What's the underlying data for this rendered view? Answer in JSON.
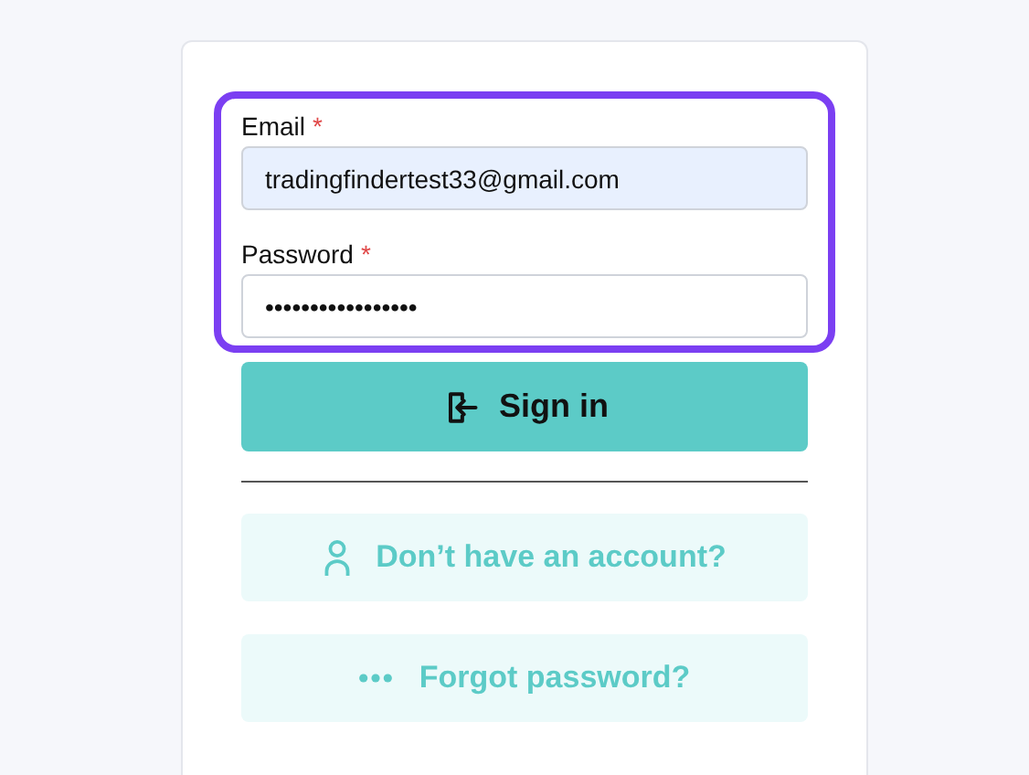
{
  "form": {
    "fields": [
      {
        "label": "Email",
        "required_mark": "*",
        "value": "tradingfindertest33@gmail.com",
        "filled": true
      },
      {
        "label": "Password",
        "required_mark": "*",
        "value": "•••••••••••••••••",
        "filled": false
      }
    ],
    "submit": {
      "label": "Sign in"
    },
    "links": [
      {
        "kind": "account",
        "label": "Don’t have an account?"
      },
      {
        "kind": "forgot",
        "label": "Forgot password?"
      }
    ]
  }
}
